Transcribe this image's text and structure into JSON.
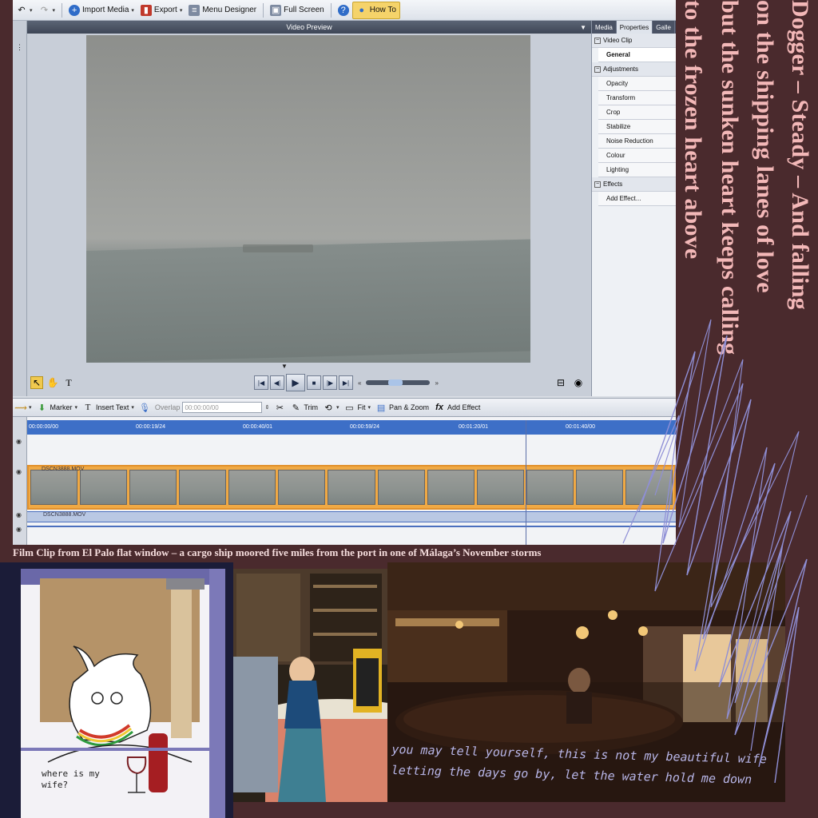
{
  "toolbar": {
    "import_media": "Import Media",
    "export": "Export",
    "menu_designer": "Menu Designer",
    "full_screen": "Full Screen",
    "how_to": "How To"
  },
  "preview": {
    "title": "Video Preview"
  },
  "side_panel": {
    "tabs": [
      "Media",
      "Properties",
      "Galle"
    ],
    "video_clip": "Video Clip",
    "general": "General",
    "adjustments": "Adjustments",
    "adjust_items": [
      "Opacity",
      "Transform",
      "Crop",
      "Stabilize",
      "Noise Reduction",
      "Colour",
      "Lighting"
    ],
    "effects": "Effects",
    "add_effect": "Add Effect..."
  },
  "timeline_toolbar": {
    "marker": "Marker",
    "insert_text": "Insert Text",
    "overlap_label": "Overlap",
    "overlap_value": "00:00:00/00",
    "trim": "Trim",
    "fit": "Fit",
    "pan_zoom": "Pan & Zoom",
    "add_effect": "Add Effect"
  },
  "timeline": {
    "ruler_ticks": [
      "00:00:00/00",
      "00:00:19/24",
      "00:00:40/01",
      "00:00:59/24",
      "00:01:20/01",
      "00:01:40/00"
    ],
    "clip_label": "DSCN3888.MOV",
    "audio_label": "DSCN3888.MOV"
  },
  "lyrics": [
    "Dogger – Steady – And falling",
    "on the shipping lanes of love",
    "but the sunken heart keeps calling",
    "to the frozen heart above"
  ],
  "caption": "Film Clip from El Palo flat window – a cargo ship moored five miles from the port in one of Málaga’s November storms",
  "sketch_text": "where is my wife?",
  "handwriting": [
    "you may tell yourself, this is not my beautiful wife",
    "letting the days go by, let the water hold me down"
  ],
  "colors": {
    "background": "#4a2a2d",
    "lyric_text": "#f3b8b8",
    "ruler": "#3d6fc7",
    "clip": "#f0a944",
    "scribble": "#8f8fd6"
  }
}
